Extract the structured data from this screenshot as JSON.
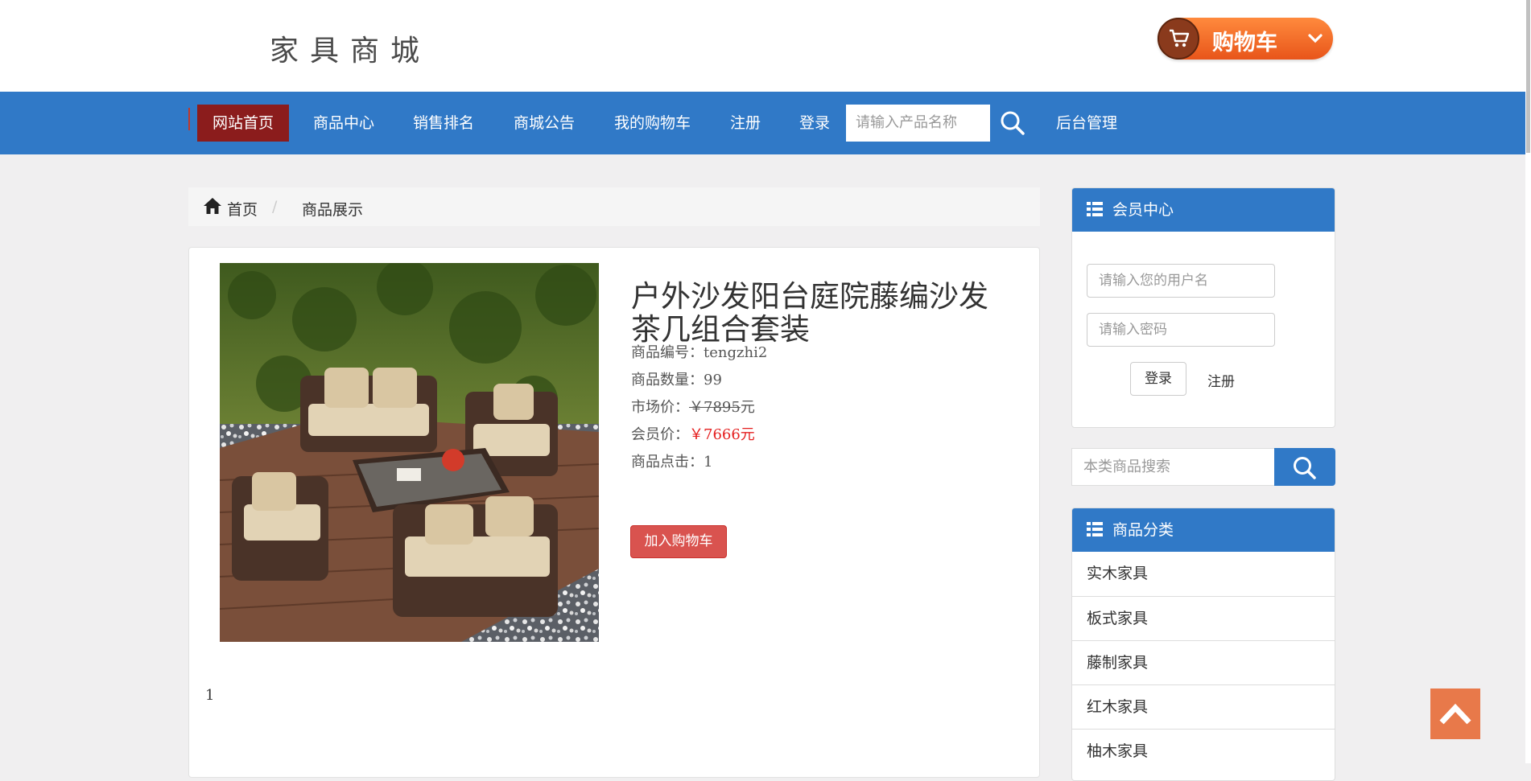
{
  "header": {
    "logo_text": "家具商城",
    "cart_button_label": "购物车"
  },
  "nav": {
    "items": [
      {
        "label": "网站首页",
        "active": true
      },
      {
        "label": "商品中心"
      },
      {
        "label": "销售排名"
      },
      {
        "label": "商城公告"
      },
      {
        "label": "我的购物车"
      },
      {
        "label": "注册"
      },
      {
        "label": "登录"
      }
    ],
    "search_placeholder": "请输入产品名称",
    "admin_label": "后台管理"
  },
  "breadcrumb": {
    "home": "首页",
    "separator": "/",
    "current": "商品展示"
  },
  "product": {
    "title": "户外沙发阳台庭院藤编沙发茶几组合套装",
    "code_label": "商品编号：",
    "code": "tengzhi2",
    "quantity_label": "商品数量：",
    "quantity": "99",
    "market_price_label": "市场价：",
    "market_price": "￥7895",
    "market_price_unit": "元",
    "member_price_label": "会员价：",
    "member_price": "￥7666元",
    "clicks_label": "商品点击：",
    "clicks": "1",
    "add_to_cart_label": "加入购物车",
    "description": "1"
  },
  "member_center": {
    "title": "会员中心",
    "username_placeholder": "请输入您的用户名",
    "password_placeholder": "请输入密码",
    "login_label": "登录",
    "register_label": "注册"
  },
  "category_search": {
    "placeholder": "本类商品搜索"
  },
  "categories": {
    "title": "商品分类",
    "items": [
      "实木家具",
      "板式家具",
      "藤制家具",
      "红木家具",
      "柚木家具"
    ]
  },
  "colors": {
    "nav_blue": "#3079c7",
    "active_nav": "#8b1c1c",
    "add_to_cart": "#d9534f",
    "price_red": "#e52020",
    "back_to_top": "#e8794a"
  }
}
